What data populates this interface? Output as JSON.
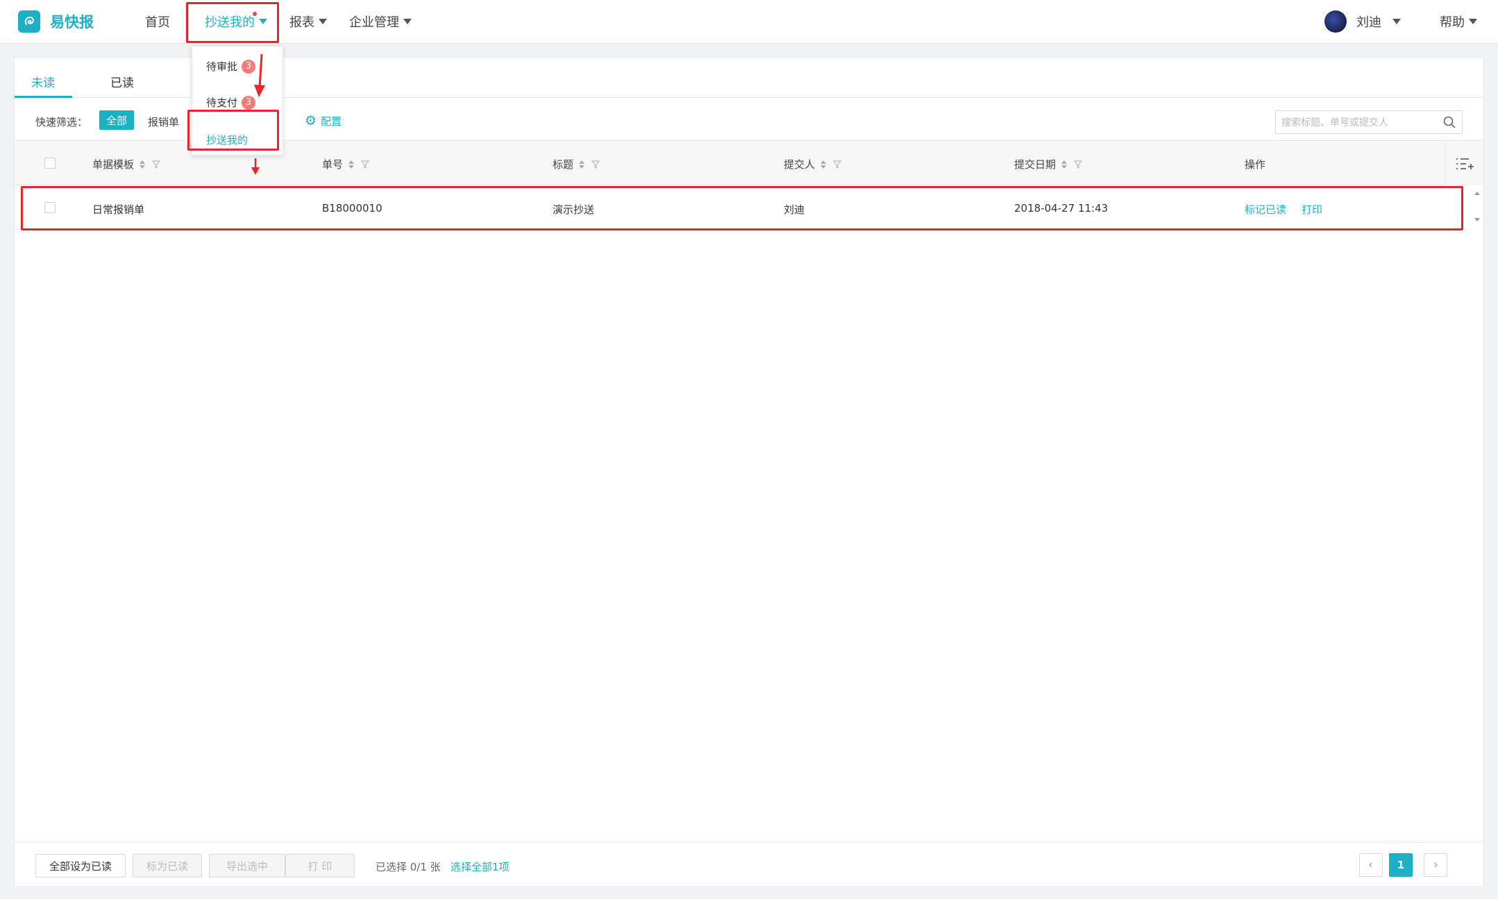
{
  "app": {
    "name": "易快报",
    "logo_icon": "logo-icon"
  },
  "nav": {
    "home": "首页",
    "cc_me": "抄送我的",
    "reports": "报表",
    "enterprise": "企业管理"
  },
  "user": {
    "name": "刘迪"
  },
  "help": "帮助",
  "dropdown": {
    "items": [
      {
        "label": "待审批",
        "badge": "3"
      },
      {
        "label": "待支付",
        "badge": "3"
      },
      {
        "label": "抄送我的",
        "badge": ""
      }
    ]
  },
  "tabs": [
    {
      "label": "未读"
    },
    {
      "label": "已读"
    }
  ],
  "filter": {
    "label": "快速筛选：",
    "all": "全部",
    "expense": "报销单",
    "config": "配置"
  },
  "search": {
    "placeholder": "搜索标题、单号或提交人"
  },
  "table": {
    "headers": [
      "单据模板",
      "单号",
      "标题",
      "提交人",
      "提交日期",
      "操作"
    ],
    "rows": [
      {
        "template": "日常报销单",
        "number": "B18000010",
        "title": "演示抄送",
        "submitter": "刘迪",
        "date": "2018-04-27 11:43",
        "action_mark": "标记已读",
        "action_print": "打印"
      }
    ]
  },
  "footer": {
    "mark_all": "全部设为已读",
    "mark_read": "标为已读",
    "export": "导出选中",
    "print": "打 印",
    "selected": "已选择 0/1 张",
    "select_all": "选择全部1项",
    "page": "1"
  },
  "colors": {
    "accent": "#1bb0c4",
    "highlight": "#e5262b",
    "badge": "#f57a7a"
  }
}
